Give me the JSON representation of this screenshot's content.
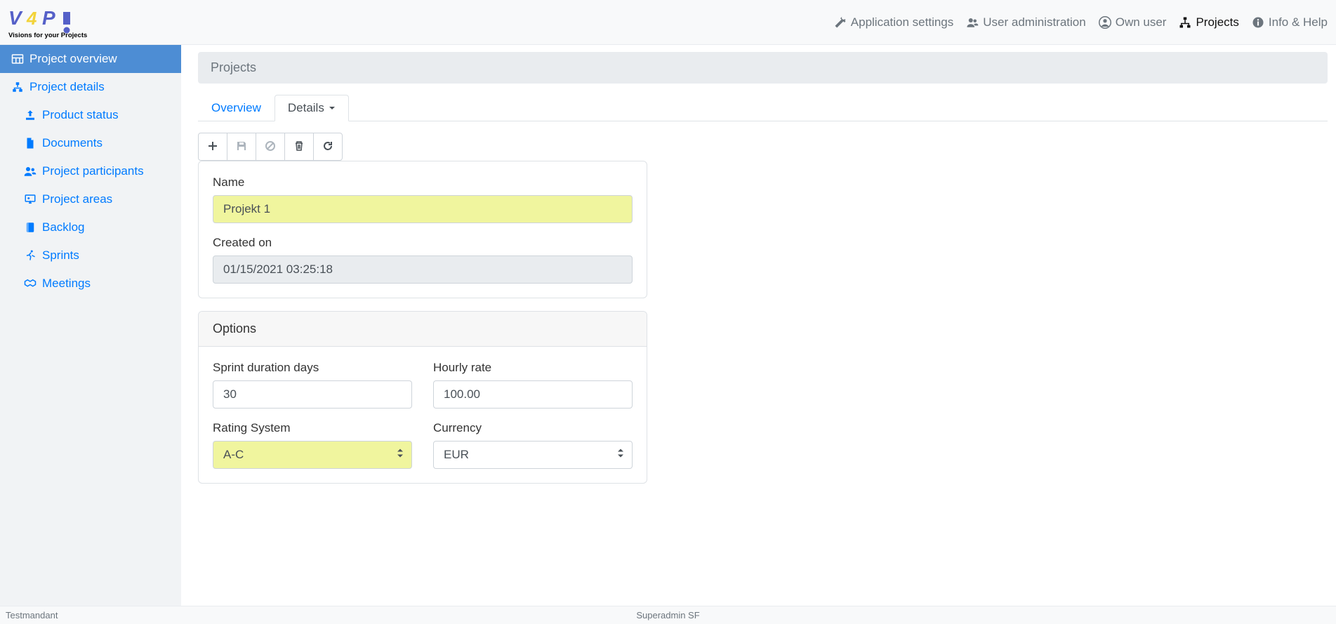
{
  "header": {
    "logo_tagline": "Visions for your Projects",
    "nav": {
      "app_settings": "Application settings",
      "user_admin": "User administration",
      "own_user": "Own user",
      "projects": "Projects",
      "info_help": "Info & Help"
    }
  },
  "sidebar": {
    "project_overview": "Project overview",
    "project_details": "Project details",
    "product_status": "Product status",
    "documents": "Documents",
    "project_participants": "Project participants",
    "project_areas": "Project areas",
    "backlog": "Backlog",
    "sprints": "Sprints",
    "meetings": "Meetings"
  },
  "page": {
    "title": "Projects"
  },
  "tabs": {
    "overview": "Overview",
    "details": "Details"
  },
  "form": {
    "name_label": "Name",
    "name_value": "Projekt 1",
    "created_on_label": "Created on",
    "created_on_value": "01/15/2021 03:25:18",
    "options_header": "Options",
    "sprint_duration_label": "Sprint duration days",
    "sprint_duration_value": "30",
    "hourly_rate_label": "Hourly rate",
    "hourly_rate_value": "100.00",
    "rating_system_label": "Rating System",
    "rating_system_value": "A-C",
    "currency_label": "Currency",
    "currency_value": "EUR"
  },
  "footer": {
    "left": "Testmandant",
    "center": "Superadmin SF"
  }
}
